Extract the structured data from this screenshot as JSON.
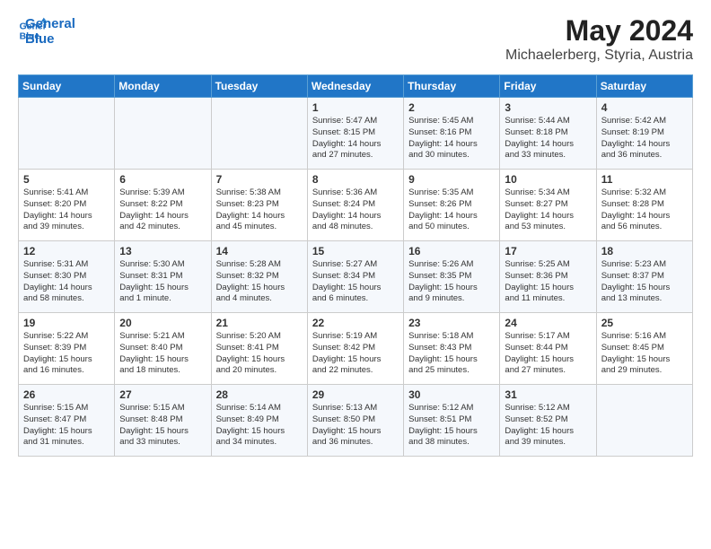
{
  "logo": {
    "line1": "General",
    "line2": "Blue"
  },
  "title": "May 2024",
  "subtitle": "Michaelerberg, Styria, Austria",
  "days_of_week": [
    "Sunday",
    "Monday",
    "Tuesday",
    "Wednesday",
    "Thursday",
    "Friday",
    "Saturday"
  ],
  "weeks": [
    [
      {
        "day": "",
        "info": ""
      },
      {
        "day": "",
        "info": ""
      },
      {
        "day": "",
        "info": ""
      },
      {
        "day": "1",
        "info": "Sunrise: 5:47 AM\nSunset: 8:15 PM\nDaylight: 14 hours\nand 27 minutes."
      },
      {
        "day": "2",
        "info": "Sunrise: 5:45 AM\nSunset: 8:16 PM\nDaylight: 14 hours\nand 30 minutes."
      },
      {
        "day": "3",
        "info": "Sunrise: 5:44 AM\nSunset: 8:18 PM\nDaylight: 14 hours\nand 33 minutes."
      },
      {
        "day": "4",
        "info": "Sunrise: 5:42 AM\nSunset: 8:19 PM\nDaylight: 14 hours\nand 36 minutes."
      }
    ],
    [
      {
        "day": "5",
        "info": "Sunrise: 5:41 AM\nSunset: 8:20 PM\nDaylight: 14 hours\nand 39 minutes."
      },
      {
        "day": "6",
        "info": "Sunrise: 5:39 AM\nSunset: 8:22 PM\nDaylight: 14 hours\nand 42 minutes."
      },
      {
        "day": "7",
        "info": "Sunrise: 5:38 AM\nSunset: 8:23 PM\nDaylight: 14 hours\nand 45 minutes."
      },
      {
        "day": "8",
        "info": "Sunrise: 5:36 AM\nSunset: 8:24 PM\nDaylight: 14 hours\nand 48 minutes."
      },
      {
        "day": "9",
        "info": "Sunrise: 5:35 AM\nSunset: 8:26 PM\nDaylight: 14 hours\nand 50 minutes."
      },
      {
        "day": "10",
        "info": "Sunrise: 5:34 AM\nSunset: 8:27 PM\nDaylight: 14 hours\nand 53 minutes."
      },
      {
        "day": "11",
        "info": "Sunrise: 5:32 AM\nSunset: 8:28 PM\nDaylight: 14 hours\nand 56 minutes."
      }
    ],
    [
      {
        "day": "12",
        "info": "Sunrise: 5:31 AM\nSunset: 8:30 PM\nDaylight: 14 hours\nand 58 minutes."
      },
      {
        "day": "13",
        "info": "Sunrise: 5:30 AM\nSunset: 8:31 PM\nDaylight: 15 hours\nand 1 minute."
      },
      {
        "day": "14",
        "info": "Sunrise: 5:28 AM\nSunset: 8:32 PM\nDaylight: 15 hours\nand 4 minutes."
      },
      {
        "day": "15",
        "info": "Sunrise: 5:27 AM\nSunset: 8:34 PM\nDaylight: 15 hours\nand 6 minutes."
      },
      {
        "day": "16",
        "info": "Sunrise: 5:26 AM\nSunset: 8:35 PM\nDaylight: 15 hours\nand 9 minutes."
      },
      {
        "day": "17",
        "info": "Sunrise: 5:25 AM\nSunset: 8:36 PM\nDaylight: 15 hours\nand 11 minutes."
      },
      {
        "day": "18",
        "info": "Sunrise: 5:23 AM\nSunset: 8:37 PM\nDaylight: 15 hours\nand 13 minutes."
      }
    ],
    [
      {
        "day": "19",
        "info": "Sunrise: 5:22 AM\nSunset: 8:39 PM\nDaylight: 15 hours\nand 16 minutes."
      },
      {
        "day": "20",
        "info": "Sunrise: 5:21 AM\nSunset: 8:40 PM\nDaylight: 15 hours\nand 18 minutes."
      },
      {
        "day": "21",
        "info": "Sunrise: 5:20 AM\nSunset: 8:41 PM\nDaylight: 15 hours\nand 20 minutes."
      },
      {
        "day": "22",
        "info": "Sunrise: 5:19 AM\nSunset: 8:42 PM\nDaylight: 15 hours\nand 22 minutes."
      },
      {
        "day": "23",
        "info": "Sunrise: 5:18 AM\nSunset: 8:43 PM\nDaylight: 15 hours\nand 25 minutes."
      },
      {
        "day": "24",
        "info": "Sunrise: 5:17 AM\nSunset: 8:44 PM\nDaylight: 15 hours\nand 27 minutes."
      },
      {
        "day": "25",
        "info": "Sunrise: 5:16 AM\nSunset: 8:45 PM\nDaylight: 15 hours\nand 29 minutes."
      }
    ],
    [
      {
        "day": "26",
        "info": "Sunrise: 5:15 AM\nSunset: 8:47 PM\nDaylight: 15 hours\nand 31 minutes."
      },
      {
        "day": "27",
        "info": "Sunrise: 5:15 AM\nSunset: 8:48 PM\nDaylight: 15 hours\nand 33 minutes."
      },
      {
        "day": "28",
        "info": "Sunrise: 5:14 AM\nSunset: 8:49 PM\nDaylight: 15 hours\nand 34 minutes."
      },
      {
        "day": "29",
        "info": "Sunrise: 5:13 AM\nSunset: 8:50 PM\nDaylight: 15 hours\nand 36 minutes."
      },
      {
        "day": "30",
        "info": "Sunrise: 5:12 AM\nSunset: 8:51 PM\nDaylight: 15 hours\nand 38 minutes."
      },
      {
        "day": "31",
        "info": "Sunrise: 5:12 AM\nSunset: 8:52 PM\nDaylight: 15 hours\nand 39 minutes."
      },
      {
        "day": "",
        "info": ""
      }
    ]
  ]
}
